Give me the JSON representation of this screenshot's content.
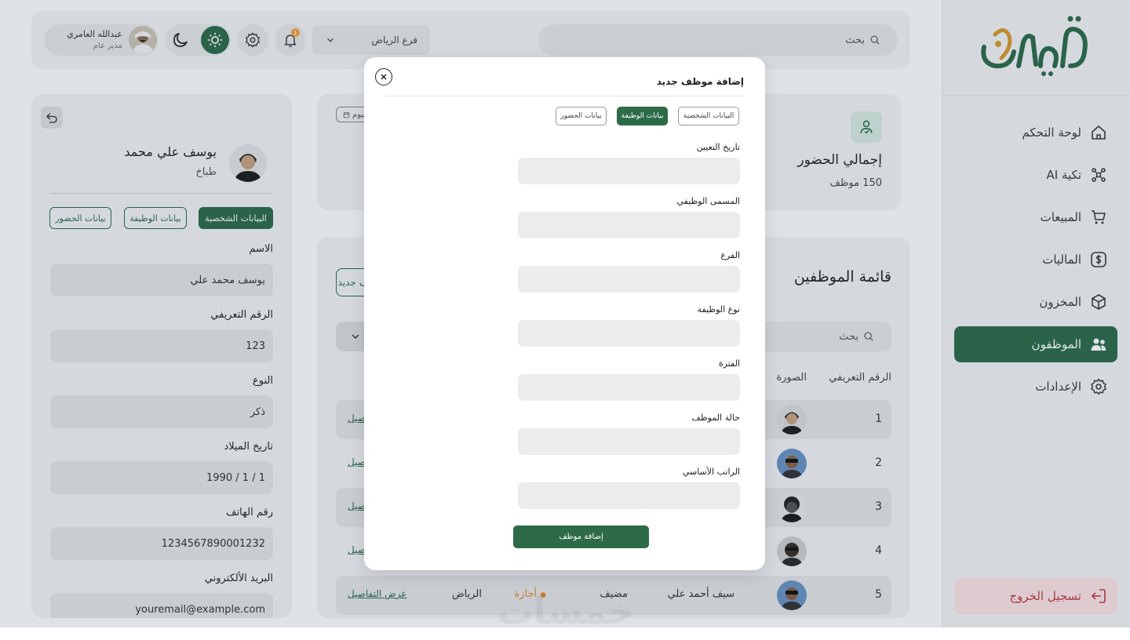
{
  "sidebar": {
    "logo_text": "تكية",
    "items": [
      {
        "label": "لوحة التحكم",
        "icon": "home-icon"
      },
      {
        "label": "تكية AI",
        "icon": "ai-icon"
      },
      {
        "label": "المبيعات",
        "icon": "cart-icon"
      },
      {
        "label": "الماليات",
        "icon": "dollar-icon"
      },
      {
        "label": "المخزون",
        "icon": "box-icon"
      },
      {
        "label": "الموظفون",
        "icon": "users-icon",
        "active": true
      },
      {
        "label": "الإعدادات",
        "icon": "gear-icon"
      }
    ],
    "logout_label": "تسجيل الخروج"
  },
  "topbar": {
    "search_placeholder": "بحث",
    "branch": "فرع الرياض",
    "notification_count": "1",
    "user_name": "عبدالله العامري",
    "user_role": "مدير عام"
  },
  "attendance": {
    "title": "إجمالي الحضور",
    "count": "150 موظف",
    "today_label": "اليوم"
  },
  "employees": {
    "title": "قائمة الموظفين",
    "add_label": "إضافة موظف جديد",
    "search_placeholder": "بحث",
    "columns": {
      "id": "الرقم التعريفي",
      "photo": "الصورة"
    },
    "rows": [
      {
        "id": "1",
        "link": "عرض التفاصيل"
      },
      {
        "id": "2",
        "link": "عرض التفاصيل"
      },
      {
        "id": "3",
        "link": "عرض التفاصيل"
      },
      {
        "id": "4",
        "link": "عرض التفاصيل"
      },
      {
        "id": "5",
        "name": "سيف أحمد علي",
        "job": "مضيف",
        "status": "أجازة",
        "branch": "الرياض",
        "link": "عرض التفاصيل"
      }
    ]
  },
  "details": {
    "name": "يوسف علي محمد",
    "role": "طباخ",
    "tabs": [
      "البيانات الشخصية",
      "بيانات الوظيفة",
      "بيانات الحضور"
    ],
    "fields": [
      {
        "label": "الاسم",
        "value": "يوسف محمد علي"
      },
      {
        "label": "الرقم التعريفي",
        "value": "123"
      },
      {
        "label": "النوع",
        "value": "ذكر"
      },
      {
        "label": "تاريخ الميلاد",
        "value": "1 / 1 / 1990"
      },
      {
        "label": "رقم الهاتف",
        "value": "1234567890001232"
      },
      {
        "label": "البريد الألكتروني",
        "value": "youremail@example.com"
      }
    ]
  },
  "modal": {
    "title": "إضافة موظف جديد",
    "tabs": [
      "البيانات الشخصية",
      "بيانات الوظيفة",
      "بيانات الحضور"
    ],
    "active_tab": "بيانات الوظيفة",
    "fields": [
      "تاريخ التعيين",
      "المسمى الوظيفي",
      "الفرع",
      "نوع الوظيفة",
      "الفترة",
      "حالة الموظف",
      "الراتب الأساسي"
    ],
    "submit_label": "إضافة موظف"
  },
  "watermark": "خمسات",
  "colors": {
    "primary": "#2d6b48",
    "logo_accent": "#d99a2b",
    "danger": "#c23b3b",
    "danger_bg": "#fde3e3"
  }
}
